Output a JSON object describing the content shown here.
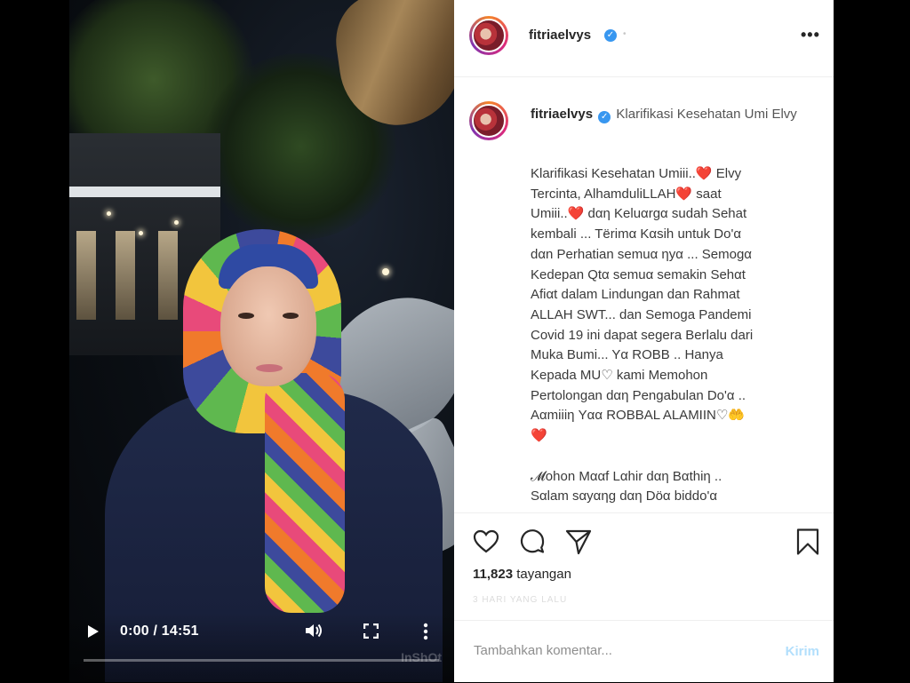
{
  "video": {
    "time_display": "0:00 / 14:51",
    "progress_fraction": 0.0,
    "watermark": "InShOt"
  },
  "post": {
    "username": "fitriaelvys",
    "verified": true,
    "caption_title": "Klarifikasi Kesehatan Umi Elvy",
    "caption_lines": [
      "Klarifikasi Kesehatan Umiii..❤️ Elvy",
      "Tercinta, AlhamduliLLAH❤️ saat",
      "Umiii..❤️ dαη Keluαrgα sudah Sehat",
      "kembali ... Tërimα Kαsih untuk Do'α",
      "dαn Perhatian semuα ηyα ... Semogα",
      "Kedepan Qtα semuα semakin Sehαt",
      "Afiαt dalam Lindungan dan Rahmat",
      "ALLAH SWT... dan Semoga Pandemi",
      "Covid 19 ini dapat segera Berlalu dari",
      "Muka Bumi... Yα ROBB .. Hanya",
      "Kepada MU♡ kami Memohon",
      "Pertolongan dαη Pengabulan Do'α ..",
      "Aαmiiiη Yαα ROBBAL ALAMIIN♡🤲",
      "❤️",
      "",
      "𝓜ohon Mααf Lαhir dαη Bαthiη ..",
      "Sαlam sαyαηg dαη Döα biddo'α"
    ],
    "views_count": "11,823",
    "views_label": "tayangan",
    "date_text": "3 HARI YANG LALU"
  },
  "comment": {
    "placeholder": "Tambahkan komentar...",
    "post_label": "Kirim"
  },
  "icons": {
    "like": "heart-outline-icon",
    "comment": "comment-bubble-icon",
    "share": "paper-plane-icon",
    "save": "bookmark-icon",
    "more": "more-horizontal-icon"
  },
  "colors": {
    "verified": "#3897f0",
    "post_button_disabled": "#b2dffc",
    "heart": "#e0245e"
  }
}
